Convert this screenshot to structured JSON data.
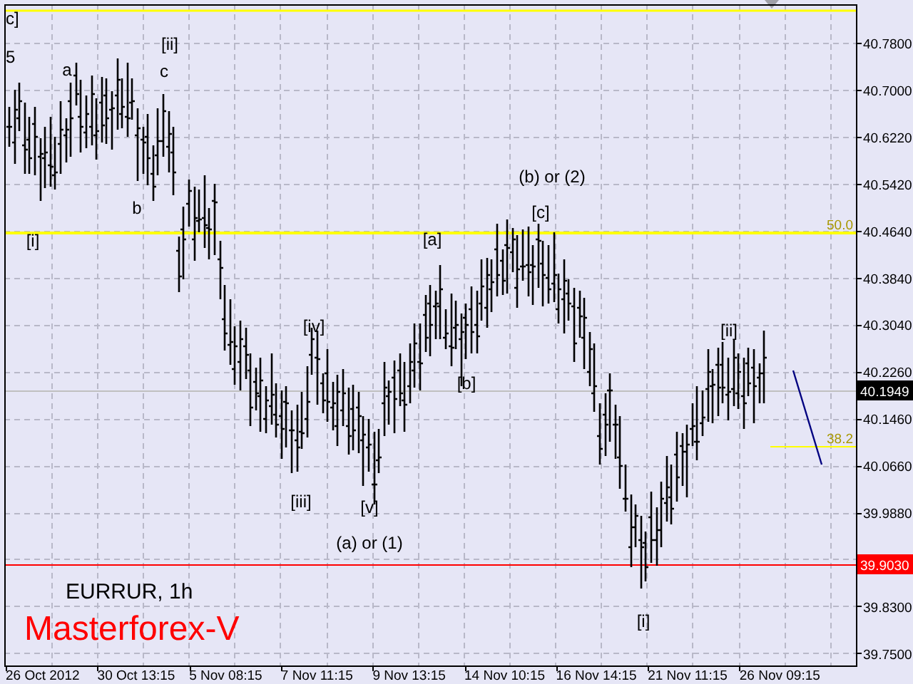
{
  "chart": {
    "symbol": "EURRUR, 1h",
    "broker": "Masterforex-V",
    "price_ticks": [
      "40.7800",
      "40.7000",
      "40.6220",
      "40.5420",
      "40.4640",
      "40.3840",
      "40.3040",
      "40.2260",
      "40.1460",
      "40.0660",
      "39.9880",
      "39.8300",
      "39.7500"
    ],
    "time_ticks": [
      "26 Oct 2012",
      "30 Oct 13:15",
      "5 Nov 08:15",
      "7 Nov 11:15",
      "9 Nov 13:15",
      "14 Nov 10:15",
      "16 Nov 14:15",
      "21 Nov 11:15",
      "26 Nov 09:15"
    ],
    "wave_labels": [
      {
        "text": "c]"
      },
      {
        "text": "5"
      },
      {
        "text": "a"
      },
      {
        "text": "[ii]"
      },
      {
        "text": "c"
      },
      {
        "text": "b"
      },
      {
        "text": "[i]"
      },
      {
        "text": "(b) or (2)"
      },
      {
        "text": "[c]"
      },
      {
        "text": "[a]"
      },
      {
        "text": "[iv]"
      },
      {
        "text": "[b]"
      },
      {
        "text": "[ii]"
      },
      {
        "text": "[iii]"
      },
      {
        "text": "[v]"
      },
      {
        "text": "(a) or (1)"
      },
      {
        "text": "[i]"
      }
    ],
    "fib_levels": [
      {
        "label": "50.0"
      },
      {
        "label": "38.2"
      }
    ],
    "price_markers": [
      {
        "kind": "bid",
        "label": "40.1949"
      },
      {
        "kind": "alert",
        "label": "39.9030"
      }
    ]
  }
}
